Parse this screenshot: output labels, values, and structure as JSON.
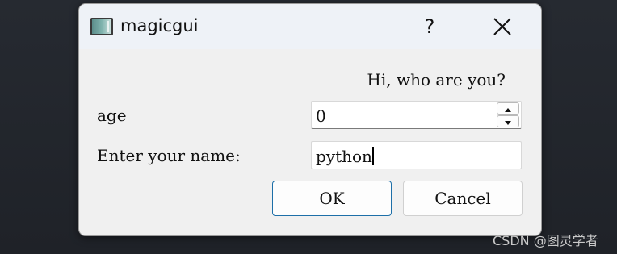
{
  "window": {
    "title": "magicgui",
    "app_icon": "window-app-icon",
    "help_label": "?",
    "close_icon": "close-icon"
  },
  "form": {
    "greeting": "Hi, who are you?",
    "age_label": "age",
    "age_value": "0",
    "name_label": "Enter your name:",
    "name_value": "python"
  },
  "buttons": {
    "ok_label": "OK",
    "cancel_label": "Cancel"
  },
  "watermark": "CSDN @图灵学者",
  "colors": {
    "ok_border": "#1d6fa8",
    "titlebar": "#eef2f7",
    "dialog_bg": "#f0f0f0"
  }
}
